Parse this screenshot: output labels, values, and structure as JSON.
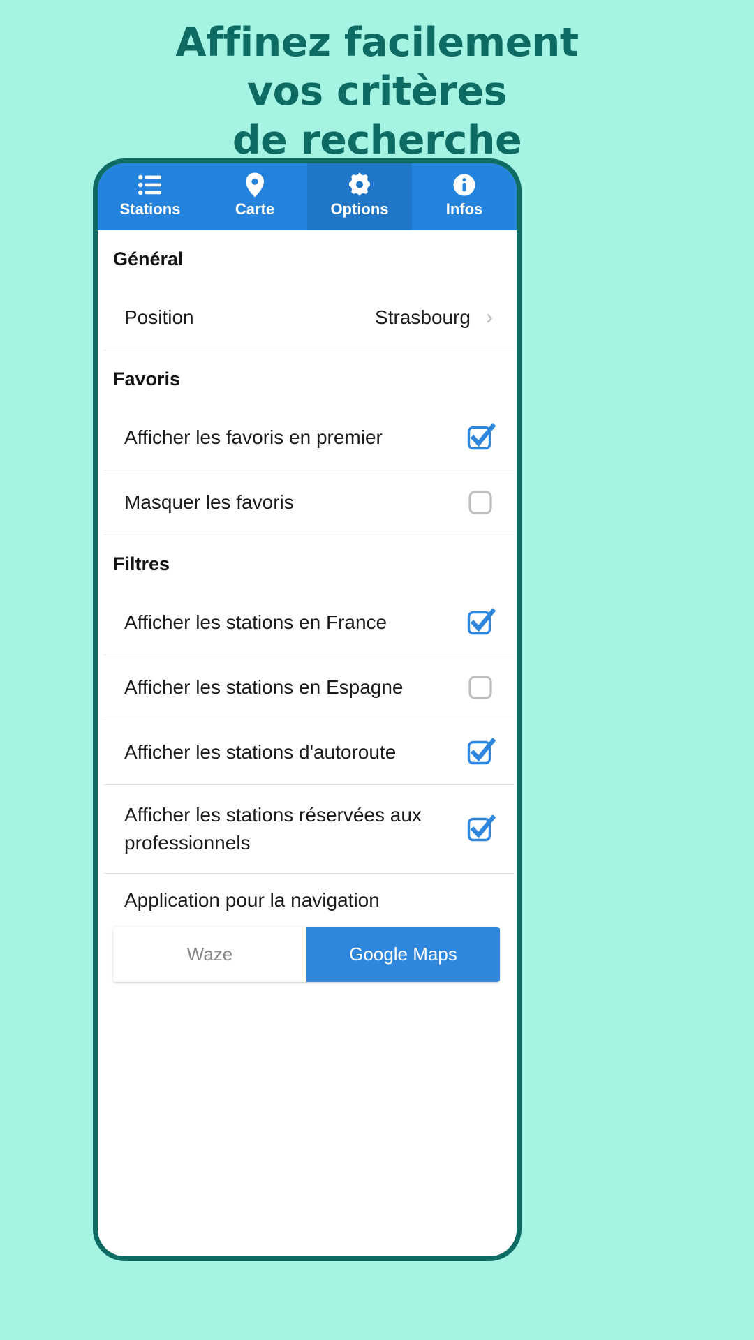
{
  "promo": {
    "headline_lines": [
      "Affinez facilement",
      "vos critères",
      "de recherche"
    ],
    "background_color": "#a5f3e2",
    "text_color": "#0d6b63"
  },
  "app": {
    "accent_color": "#2484dd",
    "active_tab_color": "#2077c8",
    "frame_color": "#0d6b63"
  },
  "tabs": [
    {
      "label": "Stations",
      "icon": "list-icon",
      "active": false
    },
    {
      "label": "Carte",
      "icon": "map-pin-icon",
      "active": false
    },
    {
      "label": "Options",
      "icon": "gear-icon",
      "active": true
    },
    {
      "label": "Infos",
      "icon": "info-circle-icon",
      "active": false
    }
  ],
  "sections": [
    {
      "header": "Général",
      "rows": [
        {
          "label": "Position",
          "value": "Strasbourg",
          "control": "chevron"
        }
      ]
    },
    {
      "header": "Favoris",
      "rows": [
        {
          "label": "Afficher les favoris en premier",
          "control": "checkbox",
          "checked": true
        },
        {
          "label": "Masquer les favoris",
          "control": "checkbox",
          "checked": false
        }
      ]
    },
    {
      "header": "Filtres",
      "rows": [
        {
          "label": "Afficher les stations en France",
          "control": "checkbox",
          "checked": true
        },
        {
          "label": "Afficher les stations en Espagne",
          "control": "checkbox",
          "checked": false
        },
        {
          "label": "Afficher les stations d'autoroute",
          "control": "checkbox",
          "checked": true
        },
        {
          "label": "Afficher les stations réservées aux professionnels",
          "control": "checkbox",
          "checked": true
        }
      ]
    }
  ],
  "navigation_app": {
    "title": "Application pour la navigation",
    "options": [
      {
        "label": "Waze",
        "selected": false
      },
      {
        "label": "Google Maps",
        "selected": true
      }
    ]
  }
}
